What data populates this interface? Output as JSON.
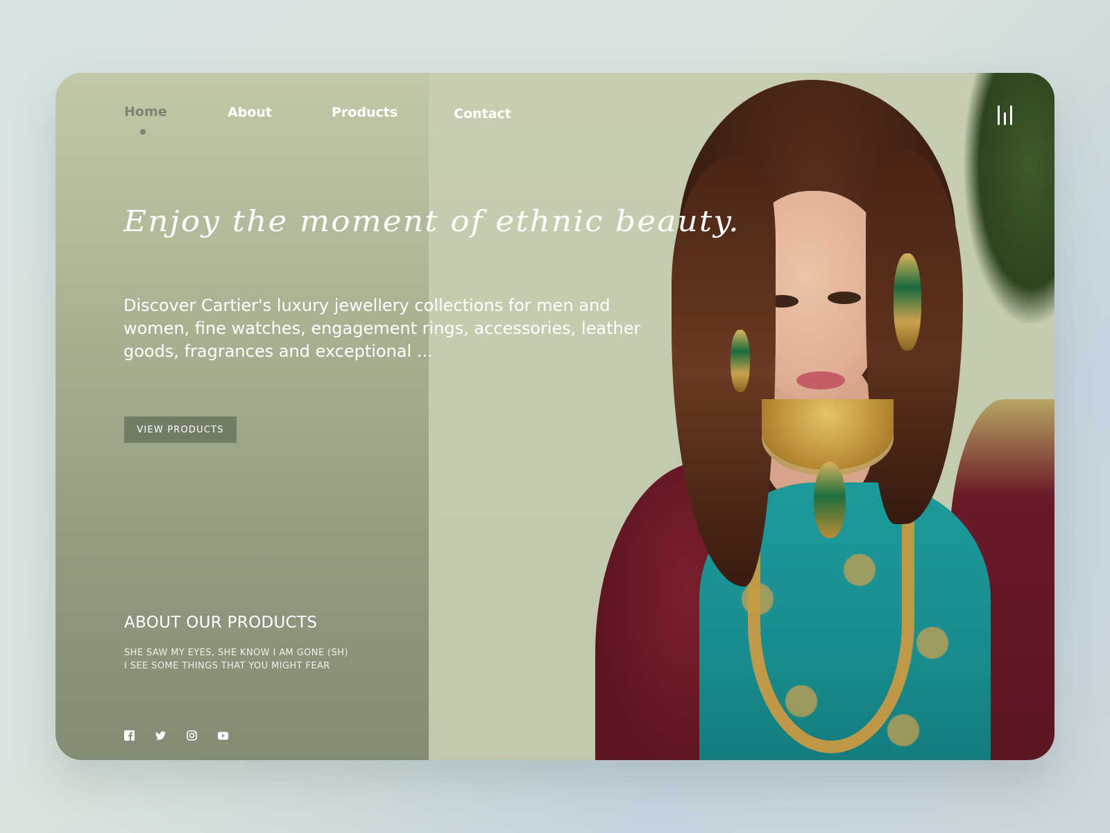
{
  "nav": {
    "items": [
      {
        "label": "Home",
        "active": true
      },
      {
        "label": "About",
        "active": false
      },
      {
        "label": "Products",
        "active": false
      },
      {
        "label": "Contact",
        "active": false
      }
    ],
    "menu_icon": "menu-bars-icon"
  },
  "hero": {
    "headline": "Enjoy the moment of ethnic beauty.",
    "description": "Discover Cartier's luxury jewellery collections for men and women, fine watches, engagement rings, accessories, leather goods, fragrances and exceptional ...",
    "cta_label": "VIEW PRODUCTS"
  },
  "about": {
    "title": "ABOUT OUR PRODUCTS",
    "line1": "SHE SAW MY EYES, SHE KNOW I AM GONE (SH)",
    "line2": "I SEE SOME THINGS THAT YOU MIGHT FEAR"
  },
  "social": [
    "facebook-icon",
    "twitter-icon",
    "instagram-icon",
    "youtube-icon"
  ],
  "colors": {
    "sage_light": "#c3cbb0",
    "sage_dark": "#838c74",
    "button": "#727d66",
    "active_nav": "#7b8470",
    "text": "#ffffff"
  }
}
